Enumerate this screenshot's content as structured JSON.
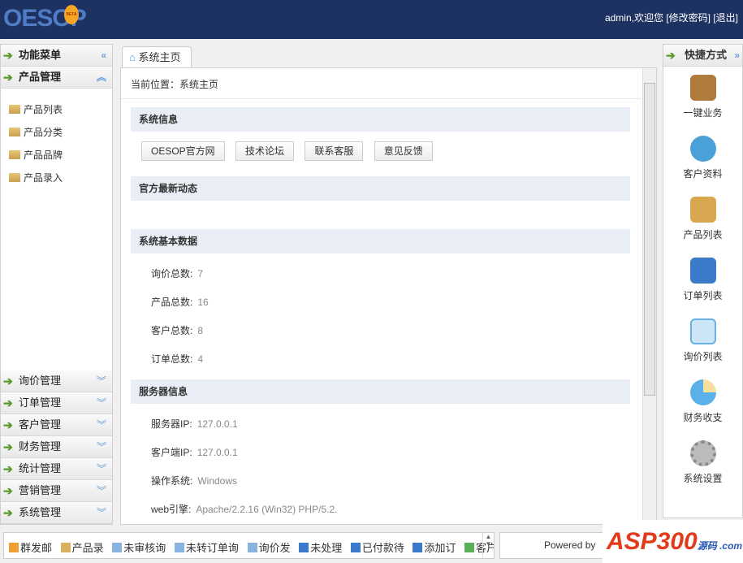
{
  "header": {
    "logo": "OESOP",
    "beta": "BETA",
    "user": "admin,欢迎您",
    "change_password": "[修改密码]",
    "logout": "[退出]"
  },
  "left": {
    "title": "功能菜单",
    "active": "产品管理",
    "items": [
      "产品列表",
      "产品分类",
      "产品品牌",
      "产品录入"
    ],
    "groups": [
      "询价管理",
      "订单管理",
      "客户管理",
      "财务管理",
      "统计管理",
      "营销管理",
      "系统管理"
    ]
  },
  "tab": "系统主页",
  "main": {
    "breadcrumb": "当前位置：系统主页",
    "sys_info": "系统信息",
    "links": [
      "OESOP官方网",
      "技术论坛",
      "联系客服",
      "意见反馈"
    ],
    "news": "官方最新动态",
    "basic": "系统基本数据",
    "stats": [
      {
        "label": "询价总数:",
        "value": "7"
      },
      {
        "label": "产品总数:",
        "value": "16"
      },
      {
        "label": "客户总数:",
        "value": "8"
      },
      {
        "label": "订单总数:",
        "value": "4"
      }
    ],
    "server": "服务器信息",
    "server_rows": [
      {
        "label": "服务器IP:",
        "value": "127.0.0.1"
      },
      {
        "label": "客户端IP:",
        "value": "127.0.0.1"
      },
      {
        "label": "操作系统:",
        "value": "Windows"
      },
      {
        "label": "web引擎:",
        "value": "Apache/2.2.16 (Win32) PHP/5.2."
      }
    ]
  },
  "right": {
    "title": "快捷方式",
    "items": [
      {
        "label": "一键业务",
        "color": "#b07a3a"
      },
      {
        "label": "客户资料",
        "color": "#4aa0d8"
      },
      {
        "label": "产品列表",
        "color": "#d8a850"
      },
      {
        "label": "订单列表",
        "color": "#3a7ac8"
      },
      {
        "label": "询价列表",
        "color": "#6ab0e0"
      },
      {
        "label": "财务收支",
        "color": "#5ab0e8"
      },
      {
        "label": "系统设置",
        "color": "#999999"
      }
    ]
  },
  "bottom": {
    "items": [
      "群发邮",
      "产品录",
      "未审核询",
      "未转订单询",
      "询价发",
      "未处理",
      "已付款待",
      "添加订",
      "客户录"
    ],
    "powered": "Powered by",
    "watermark": "ASP300",
    "watermark_sub": "源码 .com"
  }
}
